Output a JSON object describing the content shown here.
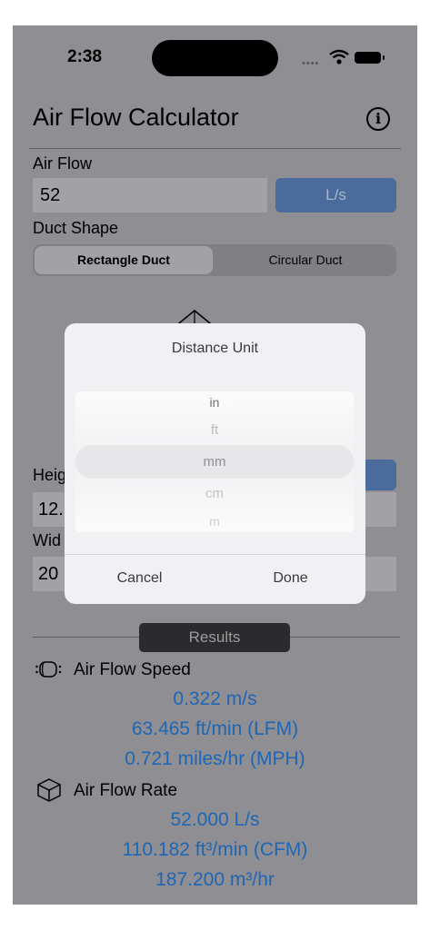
{
  "status_bar": {
    "time": "2:38"
  },
  "header": {
    "title": "Air Flow Calculator",
    "info_icon": "i"
  },
  "air_flow": {
    "label": "Air Flow",
    "value": "52",
    "unit_button": "L/s"
  },
  "duct_shape": {
    "label": "Duct Shape",
    "options": [
      "Rectangle Duct",
      "Circular Duct"
    ],
    "selected": "Rectangle Duct"
  },
  "height": {
    "label": "Heig",
    "value": "12."
  },
  "width": {
    "label": "Wid",
    "value": "20"
  },
  "results": {
    "badge": "Results",
    "speed": {
      "title": "Air Flow Speed",
      "values": [
        "0.322 m/s",
        "63.465 ft/min (LFM)",
        "0.721 miles/hr (MPH)"
      ]
    },
    "rate": {
      "title": "Air Flow Rate",
      "values": [
        "52.000 L/s",
        "110.182 ft³/min (CFM)",
        "187.200 m³/hr"
      ]
    }
  },
  "modal": {
    "title": "Distance Unit",
    "options": [
      "in",
      "ft",
      "mm",
      "cm",
      "m"
    ],
    "selected": "mm",
    "cancel": "Cancel",
    "done": "Done"
  },
  "colors": {
    "accent_button": "#4b6b9c",
    "result_text": "#1f66b5",
    "dim_background": "#8e8e93"
  }
}
